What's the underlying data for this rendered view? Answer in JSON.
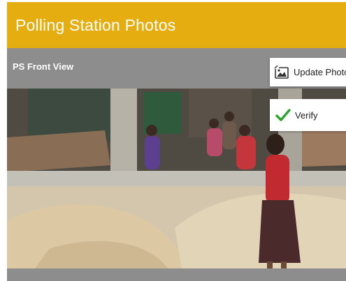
{
  "header": {
    "title": "Polling Station Photos"
  },
  "section": {
    "label": "PS Front View"
  },
  "actions": {
    "update_label": "Update Photo",
    "verify_label": "Verify"
  },
  "photo": {
    "subject": "polling-station-front-view-photo"
  },
  "colors": {
    "header_bg": "#e5ad0f",
    "section_bg": "#8d8d8d",
    "verify_check": "#2aa52a"
  }
}
